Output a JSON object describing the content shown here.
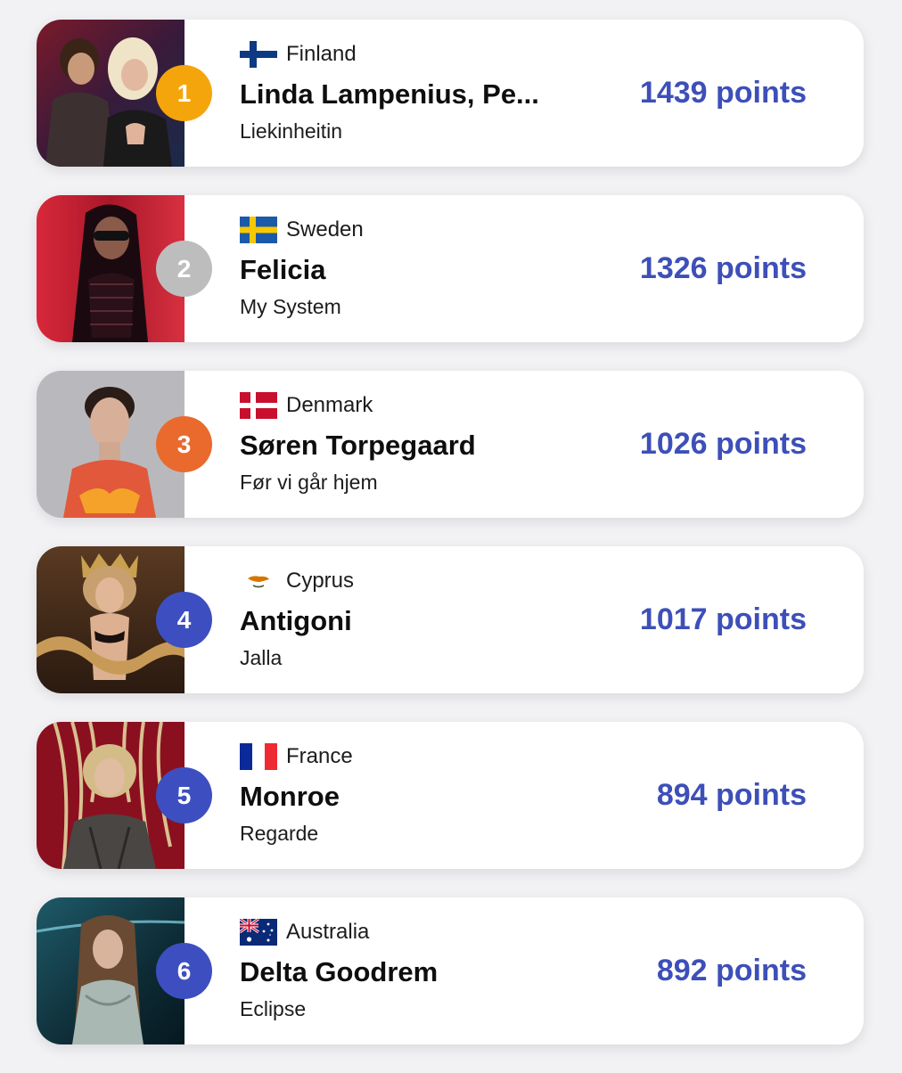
{
  "entries": [
    {
      "rank": "1",
      "rank_color": "#f5a50c",
      "country": "Finland",
      "flag": "finland-flag",
      "artist": "Linda Lampenius, Pe...",
      "song": "Liekinheitin",
      "points": "1439 points"
    },
    {
      "rank": "2",
      "rank_color": "#bdbdbd",
      "country": "Sweden",
      "flag": "sweden-flag",
      "artist": "Felicia",
      "song": "My System",
      "points": "1326 points"
    },
    {
      "rank": "3",
      "rank_color": "#ea6a2e",
      "country": "Denmark",
      "flag": "denmark-flag",
      "artist": "Søren Torpegaard",
      "song": "Før vi går hjem",
      "points": "1026 points"
    },
    {
      "rank": "4",
      "rank_color": "#3d4fc0",
      "country": "Cyprus",
      "flag": "cyprus-flag",
      "artist": "Antigoni",
      "song": "Jalla",
      "points": "1017 points"
    },
    {
      "rank": "5",
      "rank_color": "#3d4fc0",
      "country": "France",
      "flag": "france-flag",
      "artist": "Monroe",
      "song": "Regarde",
      "points": "894 points"
    },
    {
      "rank": "6",
      "rank_color": "#3d4fc0",
      "country": "Australia",
      "flag": "australia-flag",
      "artist": "Delta Goodrem",
      "song": "Eclipse",
      "points": "892 points"
    }
  ],
  "colors": {
    "points_text": "#3d4fb8",
    "card_background": "#ffffff",
    "page_background": "#f2f2f5"
  }
}
